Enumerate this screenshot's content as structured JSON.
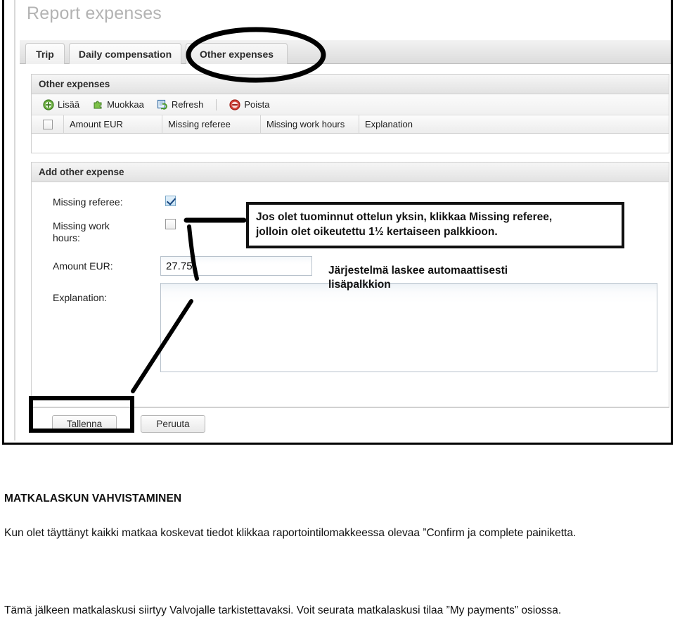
{
  "screenshot": {
    "page_title": "Report expenses",
    "tabs": [
      {
        "label": "Trip",
        "active": false
      },
      {
        "label": "Daily compensation",
        "active": false
      },
      {
        "label": "Other expenses",
        "active": true
      }
    ],
    "grid_panel": {
      "title": "Other expenses",
      "toolbar": [
        {
          "label": "Lisää",
          "icon": "add-circle-icon"
        },
        {
          "label": "Muokkaa",
          "icon": "puzzle-edit-icon"
        },
        {
          "label": "Refresh",
          "icon": "refresh-icon"
        },
        {
          "label": "Poista",
          "icon": "remove-circle-icon"
        }
      ],
      "columns": [
        "Amount EUR",
        "Missing referee",
        "Missing work hours",
        "Explanation"
      ]
    },
    "form_panel": {
      "title": "Add other expense",
      "fields": {
        "missing_referee_label": "Missing referee:",
        "missing_referee_checked": true,
        "missing_work_hours_label": "Missing work hours:",
        "missing_work_hours_checked": false,
        "amount_label": "Amount EUR:",
        "amount_value": "27.75",
        "explanation_label": "Explanation:",
        "explanation_value": ""
      },
      "buttons": {
        "save": "Tallenna",
        "cancel": "Peruuta"
      }
    },
    "annotations": {
      "callout_line1": "Jos olet tuominnut ottelun yksin, klikkaa Missing referee,",
      "callout_line2": "jolloin olet oikeutettu 1½ kertaiseen palkkioon.",
      "note_line1": "Järjestelmä laskee automaattisesti",
      "note_line2": "lisäpalkkion"
    }
  },
  "document": {
    "heading": "MATKALASKUN VAHVISTAMINEN",
    "paragraph1": "Kun olet täyttänyt kaikki matkaa koskevat tiedot klikkaa raportointilomakkeessa olevaa ”Confirm ja complete painiketta.",
    "paragraph2": "Tämä jälkeen matkalaskusi siirtyy Valvojalle tarkistettavaksi. Voit seurata matkalaskusi tilaa ”My payments” osiossa."
  }
}
